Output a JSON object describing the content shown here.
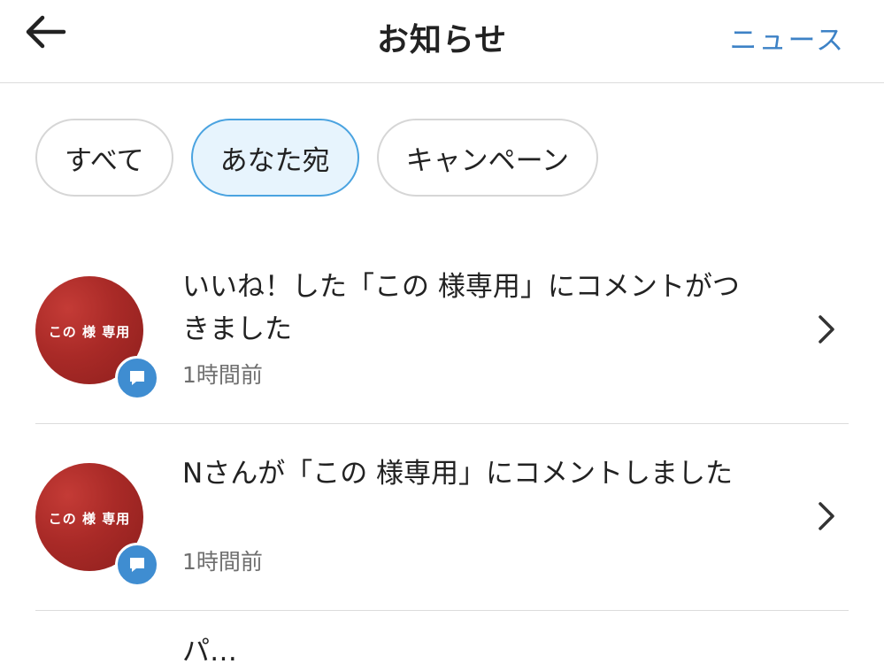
{
  "header": {
    "back_icon": "arrow-left-icon",
    "title": "お知らせ",
    "news_link": "ニュース",
    "accent_color": "#3d82c6"
  },
  "filters": [
    {
      "label": "すべて",
      "active": false
    },
    {
      "label": "あなた宛",
      "active": true
    },
    {
      "label": "キャンペーン",
      "active": false
    }
  ],
  "notifications": [
    {
      "avatar_text": "この 様 専用",
      "badge_icon": "comment-icon",
      "text": "いいね！した「この 様専用」にコメントがつきました",
      "time": "1時間前",
      "chevron_icon": "chevron-right-icon"
    },
    {
      "avatar_text": "この 様 専用",
      "badge_icon": "comment-icon",
      "text": "Nさんが「この 様専用」にコメントしました",
      "time": "1時間前",
      "chevron_icon": "chevron-right-icon"
    },
    {
      "text": "パ…"
    }
  ]
}
